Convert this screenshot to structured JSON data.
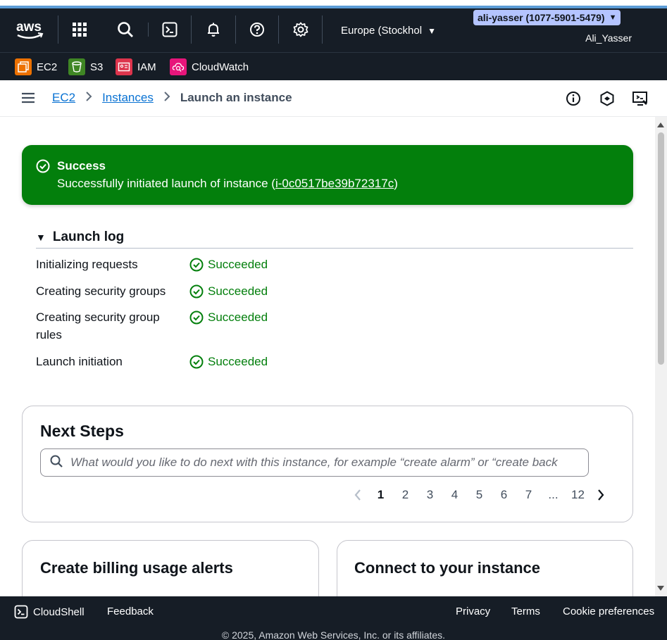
{
  "header": {
    "region": "Europe (Stockhol",
    "account": "ali-yasser (1077-5901-5479)",
    "username": "Ali_Yasser"
  },
  "favorites": [
    {
      "label": "EC2",
      "color": "#ed7100"
    },
    {
      "label": "S3",
      "color": "#3f8624"
    },
    {
      "label": "IAM",
      "color": "#dd344c"
    },
    {
      "label": "CloudWatch",
      "color": "#e7157b"
    }
  ],
  "breadcrumb": {
    "items": [
      "EC2",
      "Instances"
    ],
    "current": "Launch an instance"
  },
  "alert": {
    "title": "Success",
    "message_prefix": "Successfully initiated launch of instance (",
    "instance_id": "i-0c0517be39b72317c",
    "message_suffix": ")",
    "color": "#037f0c"
  },
  "launch_log": {
    "title": "Launch log",
    "rows": [
      {
        "label": "Initializing requests",
        "status": "Succeeded"
      },
      {
        "label": "Creating security groups",
        "status": "Succeeded"
      },
      {
        "label": "Creating security group rules",
        "status": "Succeeded"
      },
      {
        "label": "Launch initiation",
        "status": "Succeeded"
      }
    ]
  },
  "next_steps": {
    "title": "Next Steps",
    "search_placeholder": "What would you like to do next with this instance, for example “create alarm” or “create back",
    "pages": [
      "1",
      "2",
      "3",
      "4",
      "5",
      "6",
      "7",
      "...",
      "12"
    ],
    "current_page": "1"
  },
  "cards": [
    {
      "title": "Create billing usage alerts"
    },
    {
      "title": "Connect to your instance"
    }
  ],
  "footer": {
    "cloudshell": "CloudShell",
    "feedback": "Feedback",
    "privacy": "Privacy",
    "terms": "Terms",
    "cookies": "Cookie preferences",
    "copyright": "© 2025, Amazon Web Services, Inc. or its affiliates."
  }
}
